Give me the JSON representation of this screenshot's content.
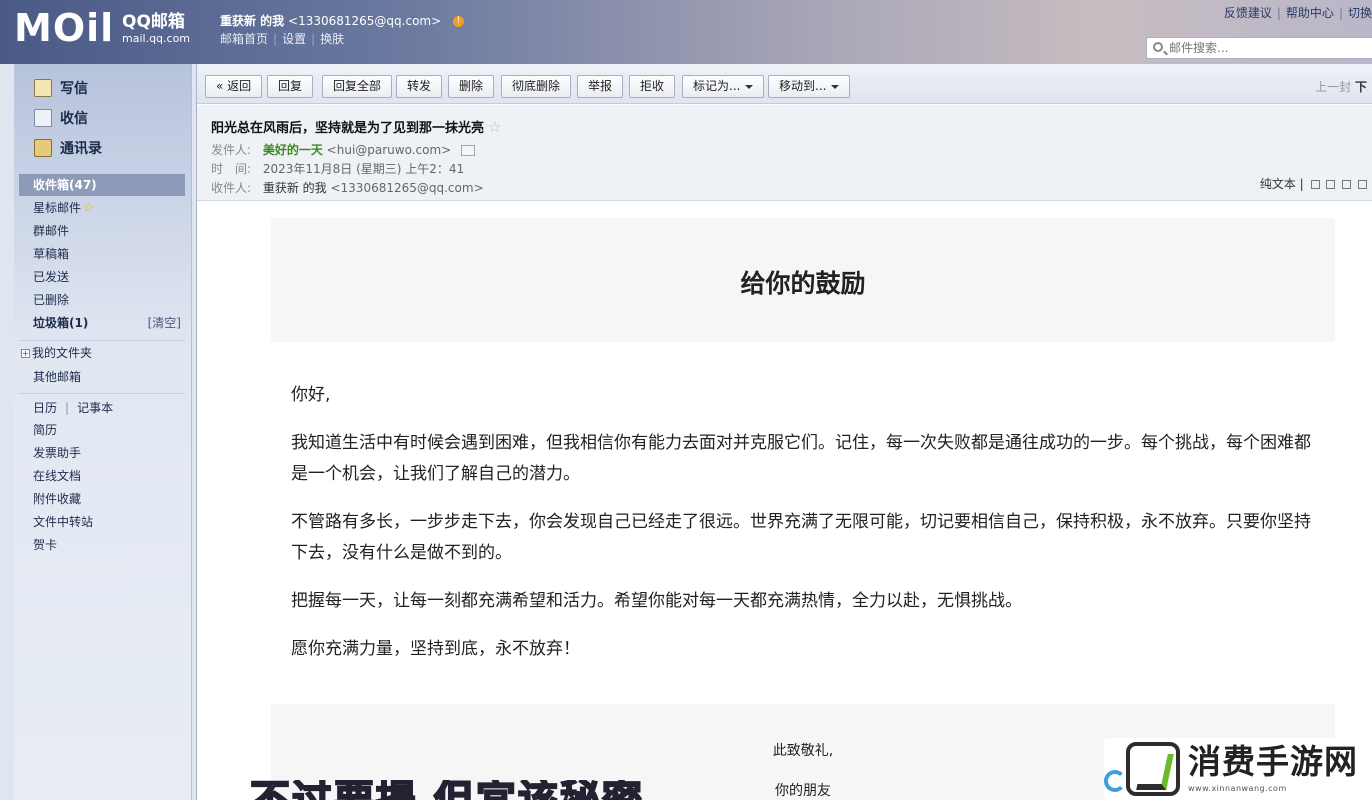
{
  "header": {
    "logo_main": "MOil",
    "logo_qq": "QQ邮箱",
    "logo_domain": "mail.qq.com",
    "account_name": "重获新 的我",
    "account_email": "<1330681265@qq.com>",
    "links": [
      "邮箱首页",
      "设置",
      "换肤"
    ],
    "top_right_links": [
      "反馈建议",
      "帮助中心",
      "切换"
    ],
    "search_placeholder": "邮件搜索..."
  },
  "sidebar": {
    "quick": [
      {
        "label": "写信",
        "icon": "compose-icon"
      },
      {
        "label": "收信",
        "icon": "inbox-envelope-icon"
      },
      {
        "label": "通讯录",
        "icon": "contacts-book-icon"
      }
    ],
    "folders": [
      {
        "label": "收件箱(47)"
      },
      {
        "label": "星标邮件"
      },
      {
        "label": "群邮件"
      },
      {
        "label": "草稿箱"
      },
      {
        "label": "已发送"
      },
      {
        "label": "已删除"
      },
      {
        "label": "垃圾箱(1)",
        "action": "[清空]"
      }
    ],
    "my_folders": "我的文件夹",
    "other_mailbox": "其他邮箱",
    "tools": {
      "calendar": "日历",
      "notes": "记事本",
      "items": [
        "简历",
        "发票助手",
        "在线文档",
        "附件收藏",
        "文件中转站",
        "贺卡"
      ]
    }
  },
  "toolbar": {
    "back": "« 返回",
    "buttons": [
      "回复",
      "回复全部",
      "转发",
      "删除",
      "彻底删除",
      "举报",
      "拒收"
    ],
    "mark_as": "标记为...",
    "move_to": "移动到...",
    "pager_prev": "上一封",
    "pager_next": "下"
  },
  "mail": {
    "subject": "阳光总在风雨后，坚持就是为了见到那一抹光亮",
    "from_label": "发件人:",
    "from_name": "美好的一天",
    "from_email": "<hui@paruwo.com>",
    "time_label": "时　间:",
    "time": "2023年11月8日 (星期三) 上午2：41",
    "to_label": "收件人:",
    "to_name": "重获新 的我",
    "to_email": "<1330681265@qq.com>",
    "plain_text": "纯文本"
  },
  "body": {
    "title": "给你的鼓励",
    "paragraphs": [
      "你好,",
      "我知道生活中有时候会遇到困难，但我相信你有能力去面对并克服它们。记住，每一次失败都是通往成功的一步。每个挑战，每个困难都是一个机会，让我们了解自己的潜力。",
      "不管路有多长，一步步走下去，你会发现自己已经走了很远。世界充满了无限可能，切记要相信自己，保持积极，永不放弃。只要你坚持下去，没有什么是做不到的。",
      "把握每一天，让每一刻都充满希望和活力。希望你能对每一天都充满热情，全力以赴，无惧挑战。",
      "愿你充满力量，坚持到底，永不放弃！"
    ],
    "closing": "此致敬礼,",
    "signature": "你的朋友"
  },
  "overlay": {
    "caption": "不过要提 但宜该秘密",
    "brand_name": "消费手游网",
    "brand_url": "www.xinnanwang.com"
  }
}
